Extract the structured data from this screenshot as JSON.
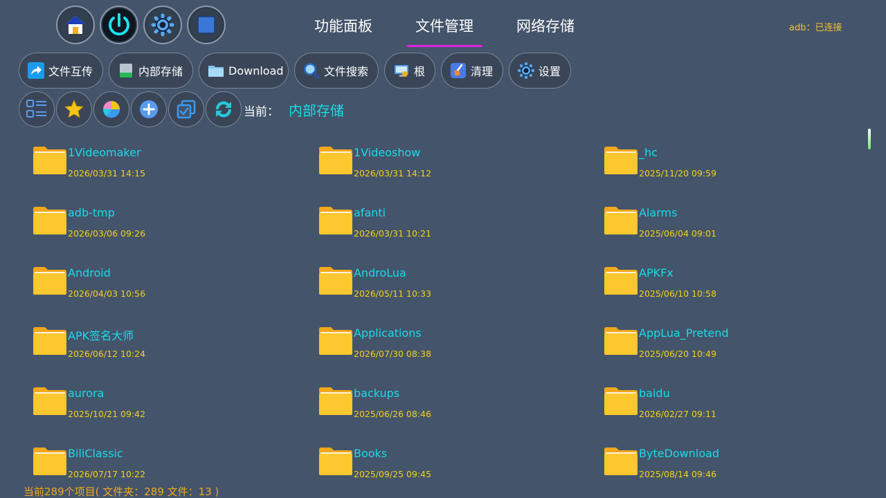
{
  "header": {
    "tabs": [
      {
        "label": "功能面板",
        "active": false
      },
      {
        "label": "文件管理",
        "active": true
      },
      {
        "label": "网络存储",
        "active": false
      }
    ],
    "status": "adb：已连接",
    "icons": [
      "home-icon",
      "power-icon",
      "gear-icon",
      "stop-icon"
    ]
  },
  "toolbar": {
    "buttons": [
      {
        "label": "文件互传",
        "icon": "share-icon"
      },
      {
        "label": "内部存储",
        "icon": "drive-icon"
      },
      {
        "label": "Download",
        "icon": "folder-icon"
      },
      {
        "label": "文件搜索",
        "icon": "search-icon"
      },
      {
        "label": "根",
        "icon": "root-icon"
      },
      {
        "label": "清理",
        "icon": "broom-icon"
      },
      {
        "label": "设置",
        "icon": "gear-icon"
      }
    ],
    "tools": [
      "view-mode-icon",
      "favorite-icon",
      "storage-chart-icon",
      "add-icon",
      "multi-select-icon",
      "refresh-icon"
    ]
  },
  "location": {
    "label": "当前：",
    "path": "内部存储"
  },
  "files": [
    {
      "name": "1Videomaker",
      "date": "2026/03/31 14:15"
    },
    {
      "name": "1Videoshow",
      "date": "2026/03/31 14:12"
    },
    {
      "name": "_hc",
      "date": "2025/11/20 09:59"
    },
    {
      "name": "adb-tmp",
      "date": "2026/03/06 09:26"
    },
    {
      "name": "afanti",
      "date": "2026/03/31 10:21"
    },
    {
      "name": "Alarms",
      "date": "2025/06/04 09:01"
    },
    {
      "name": "Android",
      "date": "2026/04/03 10:56"
    },
    {
      "name": "AndroLua",
      "date": "2026/05/11 10:33"
    },
    {
      "name": "APKFx",
      "date": "2025/06/10 10:58"
    },
    {
      "name": "APK签名大师",
      "date": "2026/06/12 10:24"
    },
    {
      "name": "Applications",
      "date": "2026/07/30 08:38"
    },
    {
      "name": "AppLua_Pretend",
      "date": "2025/06/20 10:49"
    },
    {
      "name": "aurora",
      "date": "2025/10/21 09:42"
    },
    {
      "name": "backups",
      "date": "2025/06/26 08:46"
    },
    {
      "name": "baidu",
      "date": "2026/02/27 09:11"
    },
    {
      "name": "BiliClassic",
      "date": "2026/07/17 10:22"
    },
    {
      "name": "Books",
      "date": "2025/09/25 09:45"
    },
    {
      "name": "ByteDownload",
      "date": "2025/08/14 09:46"
    }
  ],
  "footer": {
    "summary": "当前289个项目( 文件夹：289   文件：13 )"
  },
  "colors": {
    "background": "#44546a",
    "accent_cyan": "#19dbe8",
    "date_yellow": "#f2d21a",
    "tab_underline": "#e020e0",
    "status_orange": "#f2c230"
  }
}
